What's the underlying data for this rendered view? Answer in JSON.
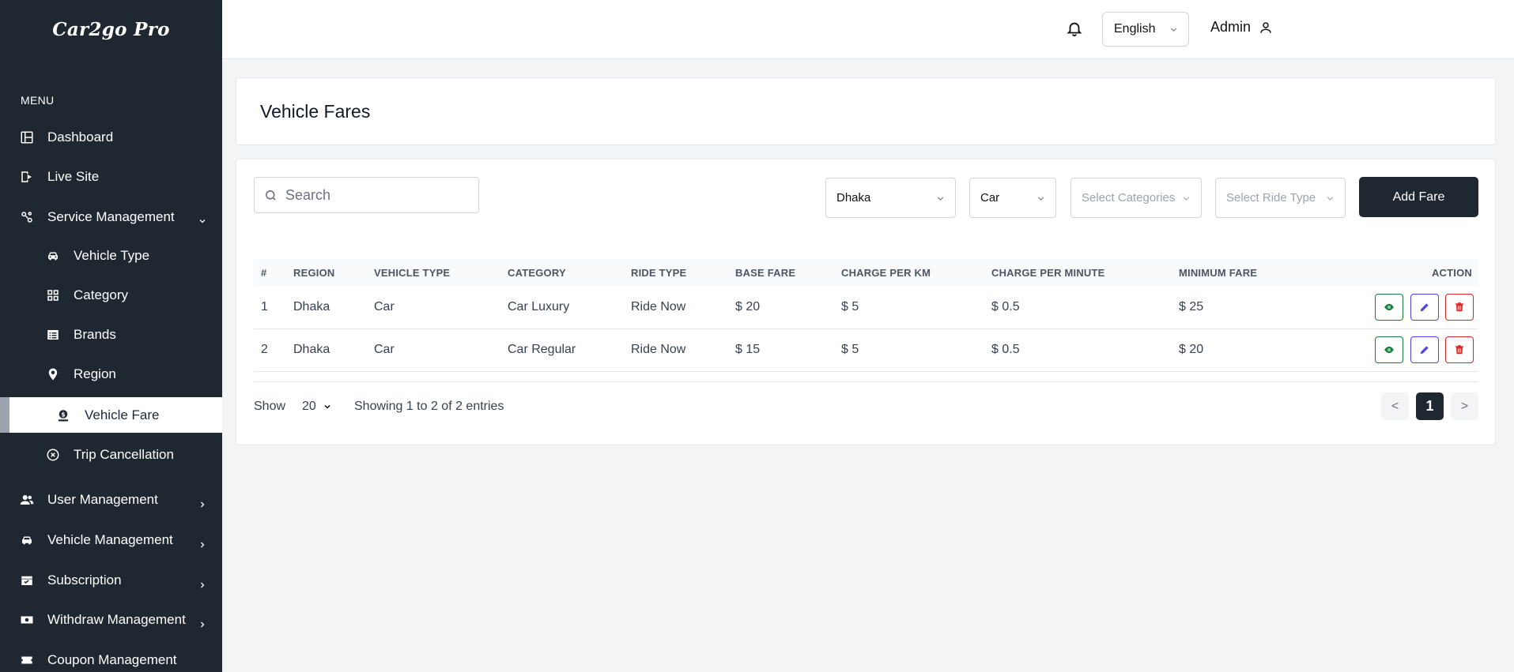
{
  "app": {
    "name": "Car2go Pro"
  },
  "sidebar": {
    "menu_label": "MENU",
    "items": [
      {
        "label": "Dashboard",
        "icon": "dashboard-icon"
      },
      {
        "label": "Live Site",
        "icon": "live-site-icon"
      },
      {
        "label": "Service Management",
        "icon": "service-management-icon",
        "expanded": true
      },
      {
        "label": "Vehicle Type",
        "icon": "car-icon"
      },
      {
        "label": "Category",
        "icon": "category-icon"
      },
      {
        "label": "Brands",
        "icon": "brands-icon"
      },
      {
        "label": "Region",
        "icon": "location-pin-icon"
      },
      {
        "label": "Vehicle Fare",
        "icon": "fare-icon",
        "active": true
      },
      {
        "label": "Trip Cancellation",
        "icon": "cancel-circle-icon"
      },
      {
        "label": "User Management",
        "icon": "users-icon"
      },
      {
        "label": "Vehicle Management",
        "icon": "vehicle-icon"
      },
      {
        "label": "Subscription",
        "icon": "subscription-icon"
      },
      {
        "label": "Withdraw Management",
        "icon": "withdraw-icon"
      },
      {
        "label": "Coupon Management",
        "icon": "coupon-icon"
      }
    ]
  },
  "header": {
    "language": "English",
    "user": "Admin"
  },
  "page": {
    "title": "Vehicle Fares"
  },
  "filters": {
    "search_placeholder": "Search",
    "region": "Dhaka",
    "vehicle_type": "Car",
    "category_placeholder": "Select Categories",
    "ride_type_placeholder": "Select Ride Type",
    "add_button": "Add Fare"
  },
  "table": {
    "columns": [
      "#",
      "REGION",
      "VEHICLE TYPE",
      "CATEGORY",
      "RIDE TYPE",
      "BASE FARE",
      "CHARGE PER KM",
      "CHARGE PER MINUTE",
      "MINIMUM FARE",
      "ACTION"
    ],
    "rows": [
      [
        "1",
        "Dhaka",
        "Car",
        "Car Luxury",
        "Ride Now",
        "$ 20",
        "$ 5",
        "$ 0.5",
        "$ 25"
      ],
      [
        "2",
        "Dhaka",
        "Car",
        "Car Regular",
        "Ride Now",
        "$ 15",
        "$ 5",
        "$ 0.5",
        "$ 20"
      ]
    ]
  },
  "footer": {
    "show_label": "Show",
    "page_size": "20",
    "entries_text": "Showing 1 to 2 of 2 entries",
    "prev": "<",
    "current_page": "1",
    "next": ">"
  },
  "colors": {
    "sidebar_bg": "#1f2731",
    "accent_dark": "#1f2731",
    "view_green": "#15803d",
    "edit_indigo": "#4f46e5",
    "delete_red": "#dc2626"
  }
}
